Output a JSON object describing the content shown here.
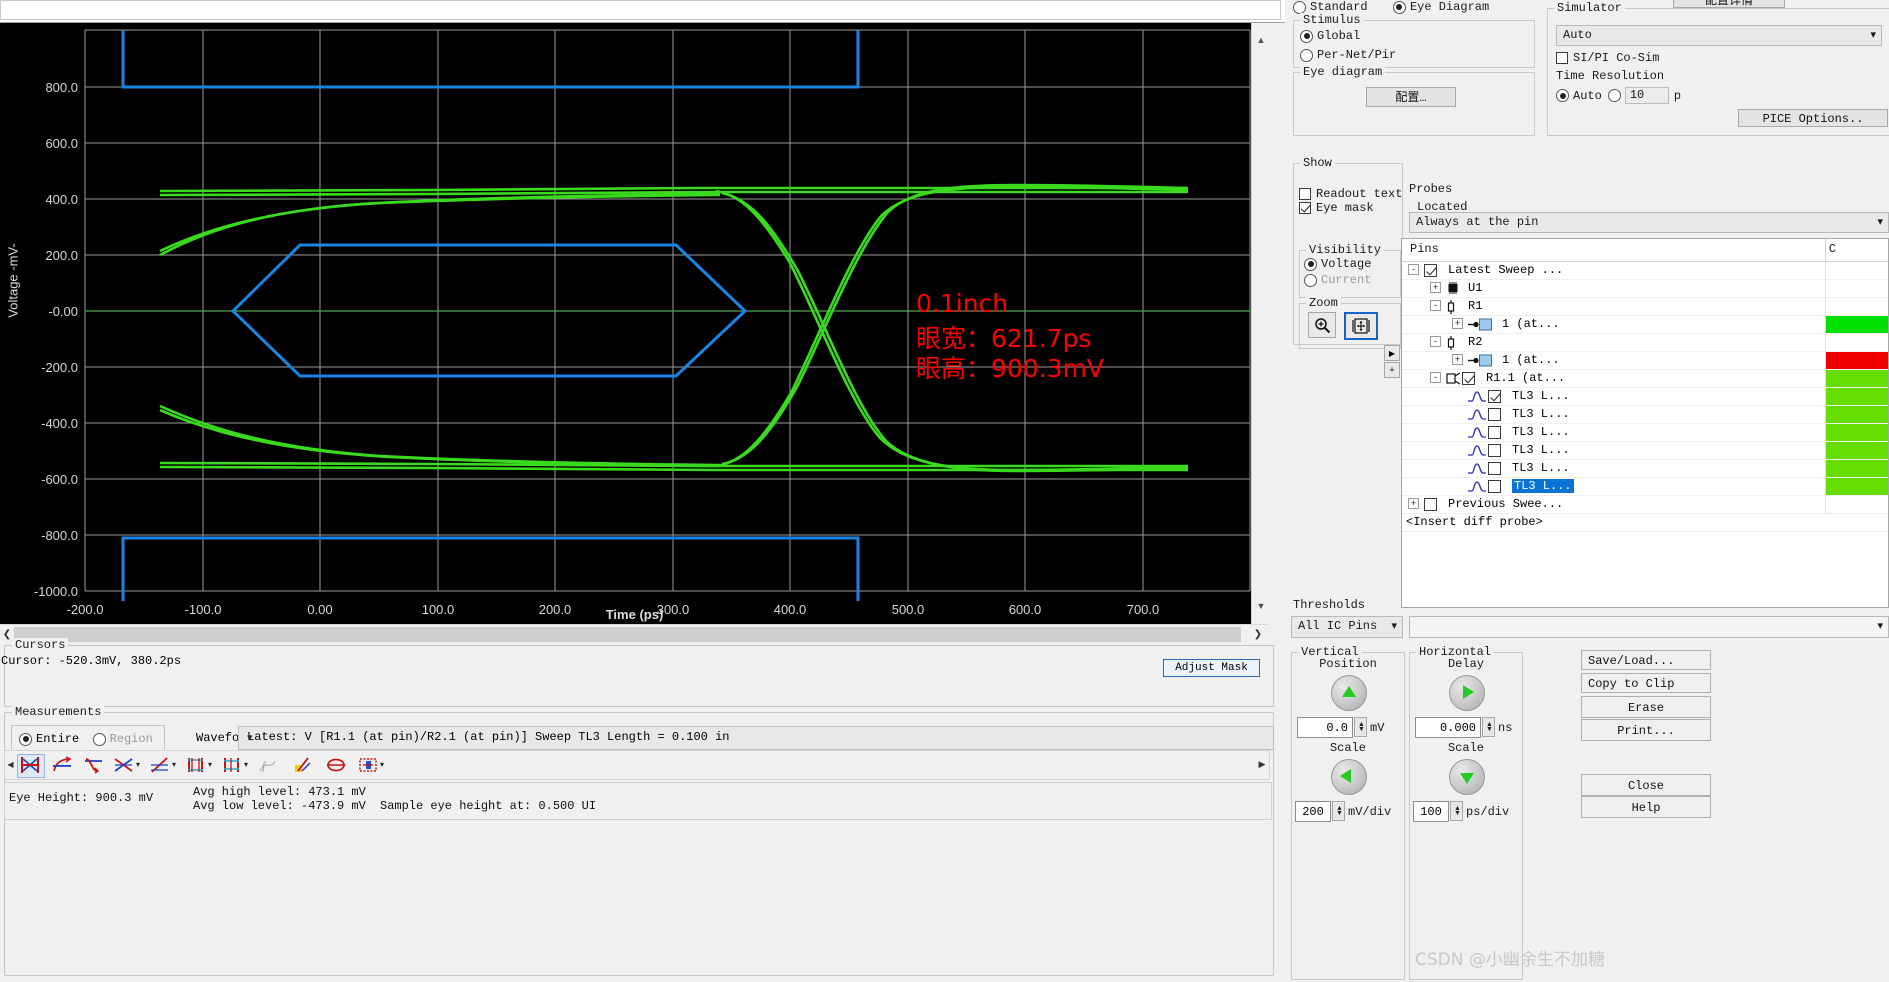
{
  "chart_data": {
    "type": "line",
    "title": "",
    "xlabel": "Time (ps)",
    "ylabel": "Voltage -mV-",
    "xlim": [
      -230,
      770
    ],
    "ylim": [
      -1060,
      960
    ],
    "xticks": [
      "-200.0",
      "-100.0",
      "0.00",
      "100.0",
      "200.0",
      "300.0",
      "400.0",
      "500.0",
      "600.0",
      "700.0"
    ],
    "yticks": [
      "800.0",
      "600.0",
      "400.0",
      "200.0",
      "-0.00",
      "-200.0",
      "-400.0",
      "-600.0",
      "-800.0",
      "-1000.0"
    ],
    "grid": true,
    "background": "#000000",
    "series": [
      {
        "name": "eye-waveform",
        "color": "#33dd22",
        "note": "green eye diagram traces, high ~473.1 mV, low ~-473.9 mV, crossing near 455 ps"
      },
      {
        "name": "eye-mask",
        "color": "#1a85e0",
        "note": "blue hexagonal eye mask plus upper/lower bounding rails"
      }
    ],
    "annotations": [
      {
        "text": "0.1inch",
        "color": "#ff0000"
      },
      {
        "text": "眼宽：621.7ps",
        "color": "#ff0000"
      },
      {
        "text": "眼高：900.3mV",
        "color": "#ff0000"
      }
    ]
  },
  "plot": {
    "ylabel": "Voltage -mV-",
    "xlabel": "Time (ps)",
    "xticks": [
      "-200.0",
      "-100.0",
      "0.00",
      "100.0",
      "200.0",
      "300.0",
      "400.0",
      "500.0",
      "600.0",
      "700.0"
    ],
    "yticks": [
      "800.0",
      "600.0",
      "400.0",
      "200.0",
      "-0.00",
      "-200.0",
      "-400.0",
      "-600.0",
      "-800.0",
      "-1000.0"
    ],
    "annotation_1": "0.1inch",
    "annotation_2": "眼宽：621.7ps",
    "annotation_3": "眼高：900.3mV",
    "annotation_color": "#ff0000"
  },
  "cursors": {
    "title": "Cursors",
    "text": "Cursor: -520.3mV,  380.2ps"
  },
  "adjust_mask_label": "Adjust Mask",
  "measurements": {
    "title": "Measurements",
    "scope_entire": "Entire",
    "scope_region": "Region",
    "waveform_label": "Waveform:",
    "waveform_value": "Latest: V [R1.1 (at pin)/R2.1 (at pin)] Sweep TL3 Length = 0.100 in",
    "stats": {
      "eye_height": "Eye Height: 900.3 mV",
      "avg_high": "Avg high level: 473.1 mV",
      "avg_low": "Avg low level: -473.9 mV",
      "sample": "Sample eye height at: 0.500 UI"
    }
  },
  "mode": {
    "standard": "Standard",
    "eye_diagram": "Eye Diagram"
  },
  "stimulus": {
    "title": "Stimulus",
    "global": "Global",
    "per_net": "Per-Net/Pir"
  },
  "eye_diagram_group": {
    "title": "Eye diagram",
    "configure_button": "配置…"
  },
  "simulator": {
    "title": "Simulator",
    "value": "Auto",
    "si_pi_cosim": "SI/PI Co-Sim",
    "time_resolution_title": "Time Resolution",
    "auto": "Auto",
    "resolution_value": "10",
    "resolution_unit": "p",
    "spice_options": "PICE Options.."
  },
  "topbar": {
    "configure_chinese": "配置详情"
  },
  "show": {
    "title": "Show",
    "readout_text": "Readout text",
    "eye_mask": "Eye mask"
  },
  "visibility": {
    "title": "Visibility",
    "voltage": "Voltage",
    "current": "Current"
  },
  "zoom_group": {
    "title": "Zoom",
    "zoom_in_icon": "magnifier-plus-icon",
    "fit_icon": "zoom-fit-icon"
  },
  "probes": {
    "title": "Probes",
    "located_label": "Located",
    "located_value": "Always at the pin",
    "col_pins": "Pins",
    "col_c": "C",
    "rows": [
      {
        "label": "Latest Sweep ...",
        "depth": 0,
        "checked": true,
        "expander": "-",
        "icon": "none",
        "color": ""
      },
      {
        "label": "U1",
        "depth": 1,
        "checked": null,
        "expander": "+",
        "icon": "chip-icon",
        "color": ""
      },
      {
        "label": "R1",
        "depth": 1,
        "checked": null,
        "expander": "-",
        "icon": "resistor-icon",
        "color": ""
      },
      {
        "label": "1 (at...",
        "depth": 2,
        "checked": null,
        "expander": "+",
        "icon": "pin-icon",
        "color": "#00e000"
      },
      {
        "label": "R2",
        "depth": 1,
        "checked": null,
        "expander": "-",
        "icon": "resistor-icon",
        "color": ""
      },
      {
        "label": "1 (at...",
        "depth": 2,
        "checked": null,
        "expander": "+",
        "icon": "pin-icon",
        "color": "#ee0000"
      },
      {
        "label": "R1.1 (at...",
        "depth": 1,
        "checked": true,
        "expander": "-",
        "icon": "diffprobe-icon",
        "color": "#66dd00"
      },
      {
        "label": "TL3 L...",
        "depth": 2,
        "checked": true,
        "expander": "",
        "icon": "wave-icon",
        "color": "#66dd00"
      },
      {
        "label": "TL3 L...",
        "depth": 2,
        "checked": false,
        "expander": "",
        "icon": "wave-icon",
        "color": "#66dd00"
      },
      {
        "label": "TL3 L...",
        "depth": 2,
        "checked": false,
        "expander": "",
        "icon": "wave-icon",
        "color": "#66dd00"
      },
      {
        "label": "TL3 L...",
        "depth": 2,
        "checked": false,
        "expander": "",
        "icon": "wave-icon",
        "color": "#66dd00"
      },
      {
        "label": "TL3 L...",
        "depth": 2,
        "checked": false,
        "expander": "",
        "icon": "wave-icon",
        "color": "#66dd00"
      },
      {
        "label": "TL3 L...",
        "depth": 2,
        "checked": false,
        "expander": "",
        "icon": "wave-icon",
        "color": "#66dd00",
        "selected": true
      },
      {
        "label": "Previous Swee...",
        "depth": 0,
        "checked": false,
        "expander": "+",
        "icon": "none",
        "color": ""
      }
    ],
    "insert_diff_probe": "<Insert diff probe>"
  },
  "thresholds": {
    "title": "Thresholds",
    "value": "All IC Pins",
    "second_value": ""
  },
  "vertical": {
    "title": "Vertical",
    "position_label": "Position",
    "position_value": "0.0",
    "position_unit": "mV",
    "scale_label": "Scale",
    "scale_value": "200",
    "scale_unit": "mV/div"
  },
  "horizontal": {
    "title": "Horizontal",
    "delay_label": "Delay",
    "delay_value": "0.000",
    "delay_unit": "ns",
    "scale_label": "Scale",
    "scale_value": "100",
    "scale_unit": "ps/div"
  },
  "side_buttons": {
    "save_load": "Save/Load...",
    "copy_to_clip": "Copy to Clip",
    "erase": "Erase",
    "print": "Print...",
    "close": "Close",
    "help": "Help"
  },
  "watermark": "CSDN @小幽余生不加糖"
}
